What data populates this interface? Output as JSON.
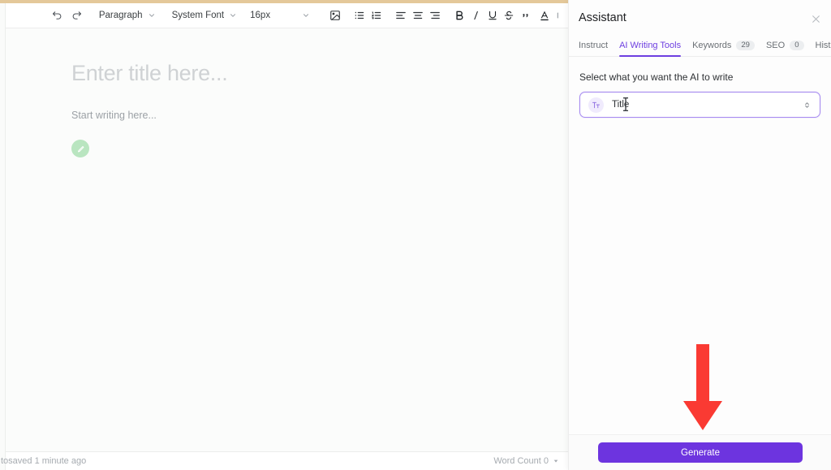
{
  "colors": {
    "top_strip": "#e4c89a",
    "accent_purple": "#6d3fe0",
    "generate_button": "#6d34df",
    "annotation_arrow": "#fa3a33",
    "pencil_fab": "#b9e5c0",
    "tab_badge_bg": "#eceef0"
  },
  "toolbar": {
    "undo_label": "Undo",
    "redo_label": "Redo",
    "block_format": {
      "value": "Paragraph",
      "caret_icon": "chevron-down-icon"
    },
    "font_family": {
      "value": "System Font",
      "caret_icon": "chevron-down-icon"
    },
    "font_size": {
      "value": "16px",
      "caret_icon": "chevron-down-icon"
    },
    "items": [
      {
        "name": "image-icon",
        "label": "Insert image"
      },
      {
        "name": "bulleted-list-icon",
        "label": "Bulleted list"
      },
      {
        "name": "numbered-list-icon",
        "label": "Numbered list"
      },
      {
        "name": "align-left-icon",
        "label": "Align left"
      },
      {
        "name": "align-center-icon",
        "label": "Align center"
      },
      {
        "name": "align-right-icon",
        "label": "Align right"
      },
      {
        "name": "bold-icon",
        "label": "B"
      },
      {
        "name": "italic-icon",
        "label": "I"
      },
      {
        "name": "underline-icon",
        "label": "U"
      },
      {
        "name": "strikethrough-icon",
        "label": "S"
      },
      {
        "name": "blockquote-icon",
        "label": "”"
      },
      {
        "name": "text-color-icon",
        "label": "A"
      }
    ]
  },
  "editor": {
    "title_placeholder": "Enter title here...",
    "body_placeholder": "Start writing here...",
    "fab_icon": "pencil-icon"
  },
  "statusbar": {
    "autosave_text": "tosaved 1 minute ago",
    "word_count_label": "Word Count 0",
    "word_count_caret": "caret-down-icon"
  },
  "panel": {
    "title": "Assistant",
    "close_icon": "close-icon",
    "tabs": [
      {
        "label": "Instruct",
        "badge": null,
        "active": false
      },
      {
        "label": "AI Writing Tools",
        "badge": null,
        "active": true
      },
      {
        "label": "Keywords",
        "badge": "29",
        "active": false
      },
      {
        "label": "SEO",
        "badge": "0",
        "active": false
      },
      {
        "label": "History",
        "badge": null,
        "active": false
      }
    ],
    "select_label": "Select what you want the AI to write",
    "select": {
      "value": "Title",
      "icon": "text-format-icon",
      "chevron_icon": "chevron-up-down-icon",
      "options": [
        "Title"
      ]
    },
    "generate_label": "Generate"
  },
  "annotation": {
    "arrow_icon": "arrow-down-icon",
    "points_to": "Generate"
  }
}
